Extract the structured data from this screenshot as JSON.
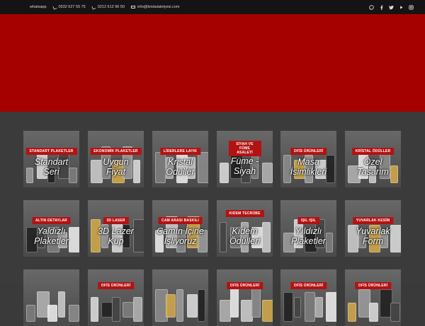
{
  "topbar": {
    "whatsapp_label": "whatsapp",
    "phone1": "0532 627 55 75",
    "phone2": "0212 612 96 50",
    "email": "info@kristalatolyesi.com",
    "social_icons": [
      "whatsapp-icon",
      "facebook-icon",
      "twitter-icon",
      "youtube-icon",
      "instagram-icon"
    ]
  },
  "colors": {
    "hero": "#a50100",
    "badge": "#b31212",
    "topbar": "#141414",
    "grid_bg": "#3b3b3b"
  },
  "tiles": [
    {
      "badge": "STANDART PLAKETLER",
      "title_lines": [
        "Standart",
        "Seri"
      ]
    },
    {
      "badge": "EKONOMİK PLAKETLER",
      "title_lines": [
        "Uygun",
        "Fiyat"
      ]
    },
    {
      "badge": "LİDERLERE LAYIK",
      "title_lines": [
        "Kristal",
        "Ödüller"
      ]
    },
    {
      "badge": "SİYAH VE FÜME ASALETİ",
      "title_lines": [
        "Füme -",
        "Siyah"
      ]
    },
    {
      "badge": "OFİS ÜRÜNLERİ",
      "title_lines": [
        "Masa",
        "İsimlikleri"
      ]
    },
    {
      "badge": "KRİSTAL ÖDÜLLER",
      "title_lines": [
        "Özel",
        "Tasarım"
      ]
    },
    {
      "badge": "ALTIN DETAYLAR",
      "title_lines": [
        "Yaldızlı",
        "Plaketler"
      ]
    },
    {
      "badge": "3D LASER",
      "title_lines": [
        "3D Lazer",
        "Küp"
      ]
    },
    {
      "badge": "CAM ARASI BASKILI",
      "title_lines": [
        "Camın İçine",
        "İşliyoruz"
      ]
    },
    {
      "badge": "KIDEM TECRÜBE",
      "title_lines": [
        "Kıdem",
        "Ödülleri"
      ]
    },
    {
      "badge": "IŞIL IŞIL",
      "title_lines": [
        "Yıldızlı",
        "Plaketler"
      ]
    },
    {
      "badge": "YUVARLAK KESİM",
      "title_lines": [
        "Yuvarlak",
        "Form"
      ]
    },
    {
      "badge": "",
      "title_lines": []
    },
    {
      "badge": "OFİS ÜRÜNLERİ",
      "title_lines": []
    },
    {
      "badge": "",
      "title_lines": []
    },
    {
      "badge": "OFİS ÜRÜNLERİ",
      "title_lines": []
    },
    {
      "badge": "OFİS ÜRÜNLERİ",
      "title_lines": []
    },
    {
      "badge": "OFİS ÜRÜNLERİ",
      "title_lines": []
    }
  ]
}
